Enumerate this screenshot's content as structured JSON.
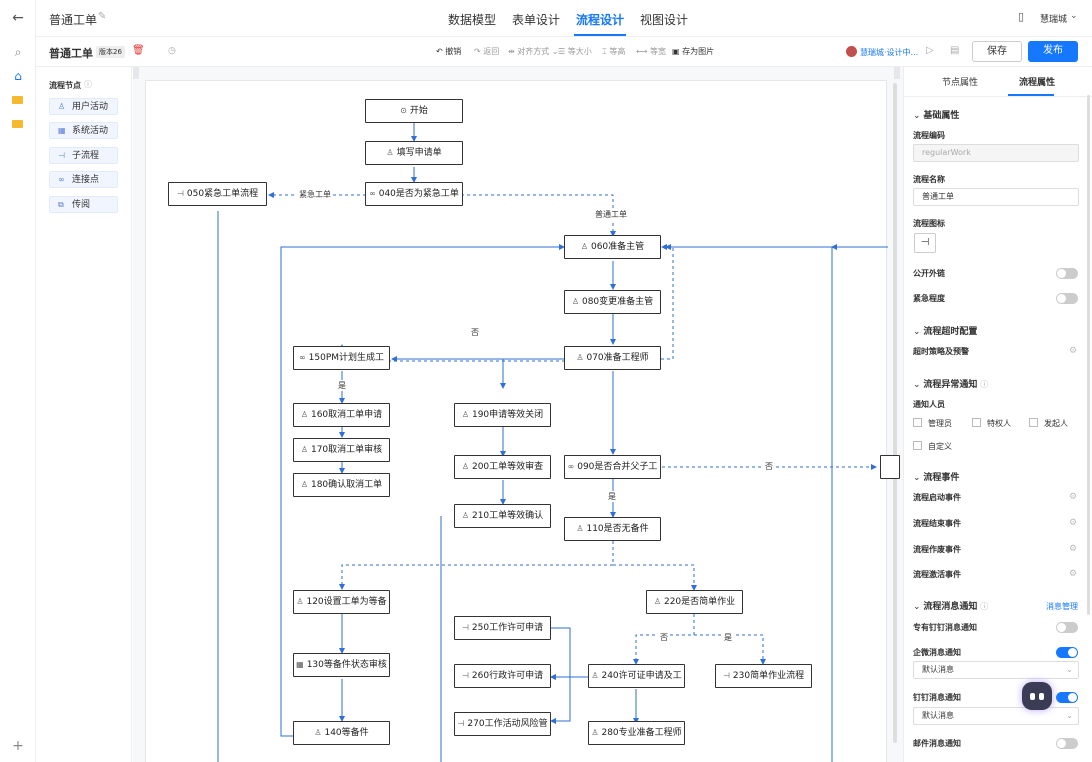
{
  "app": {
    "back_icon": "arrow-left-icon",
    "title": "普通工单",
    "tabs": [
      {
        "label": "数据模型",
        "active": false
      },
      {
        "label": "表单设计",
        "active": false
      },
      {
        "label": "流程设计",
        "active": true
      },
      {
        "label": "视图设计",
        "active": false
      }
    ],
    "user": "慧瑞城"
  },
  "toolbar": {
    "title": "普通工单",
    "version": "版本26",
    "undo": "撤销",
    "redo": "返回",
    "align": "对齐方式",
    "same_size": "等大小",
    "same_height": "等高",
    "same_width": "等宽",
    "save_image": "存为图片",
    "status_user": "慧瑞城·设计中...",
    "save": "保存",
    "publish": "发布"
  },
  "palette": {
    "title": "流程节点",
    "items": [
      "用户活动",
      "系统活动",
      "子流程",
      "连接点",
      "传阅"
    ]
  },
  "flow": {
    "nodes": {
      "start": "开始",
      "n010": "填写申请单",
      "n040": "040是否为紧急工单",
      "n050": "050紧急工单流程",
      "n060": "060准备主管",
      "n080": "080变更准备主管",
      "n070": "070准备工程师",
      "n150": "150PM计划生成工",
      "n160": "160取消工单申请",
      "n170": "170取消工单审核",
      "n180": "180确认取消工单",
      "n190": "190申请等效关闭",
      "n200": "200工单等效审查",
      "n210": "210工单等效确认",
      "n090": "090是否合并父子工",
      "n110": "110是否无备件",
      "n120": "120设置工单为等备",
      "n130": "130等备件状态审核",
      "n140": "140等备件",
      "n220": "220是否简单作业",
      "n250": "250工作许可申请",
      "n260": "260行政许可申请",
      "n270": "270工作活动风险管",
      "n240": "240许可证申请及工",
      "n230": "230简单作业流程",
      "n280": "280专业准备工程师"
    },
    "labels": {
      "urgent": "紧急工单",
      "normal": "普通工单",
      "no1": "否",
      "yes1": "是",
      "yes2": "是",
      "no2": "否",
      "no3": "否",
      "yes3": "是"
    }
  },
  "panel": {
    "tabs": [
      "节点属性",
      "流程属性"
    ],
    "active_tab": 1,
    "basic": "基础属性",
    "code_label": "流程编码",
    "code_value": "regularWork",
    "name_label": "流程名称",
    "name_value": "普通工单",
    "icon_label": "流程图标",
    "public_label": "公开外链",
    "urgency_label": "紧急程度",
    "timeout_sec": "流程超时配置",
    "timeout_label": "超时策略及预警",
    "exception_sec": "流程异常通知",
    "notify_label": "通知人员",
    "notify_options": [
      "管理员",
      "特权人",
      "发起人"
    ],
    "custom": "自定义",
    "events_sec": "流程事件",
    "events": [
      "流程启动事件",
      "流程结束事件",
      "流程作废事件",
      "流程激活事件"
    ],
    "msg_sec": "流程消息通知",
    "msg_manage": "消息管理",
    "msg": [
      {
        "label": "专有钉钉消息通知",
        "on": false
      },
      {
        "label": "企微消息通知",
        "on": true,
        "select": "默认消息"
      },
      {
        "label": "钉钉消息通知",
        "on": true,
        "select": "默认消息"
      },
      {
        "label": "邮件消息通知",
        "on": false
      }
    ]
  }
}
